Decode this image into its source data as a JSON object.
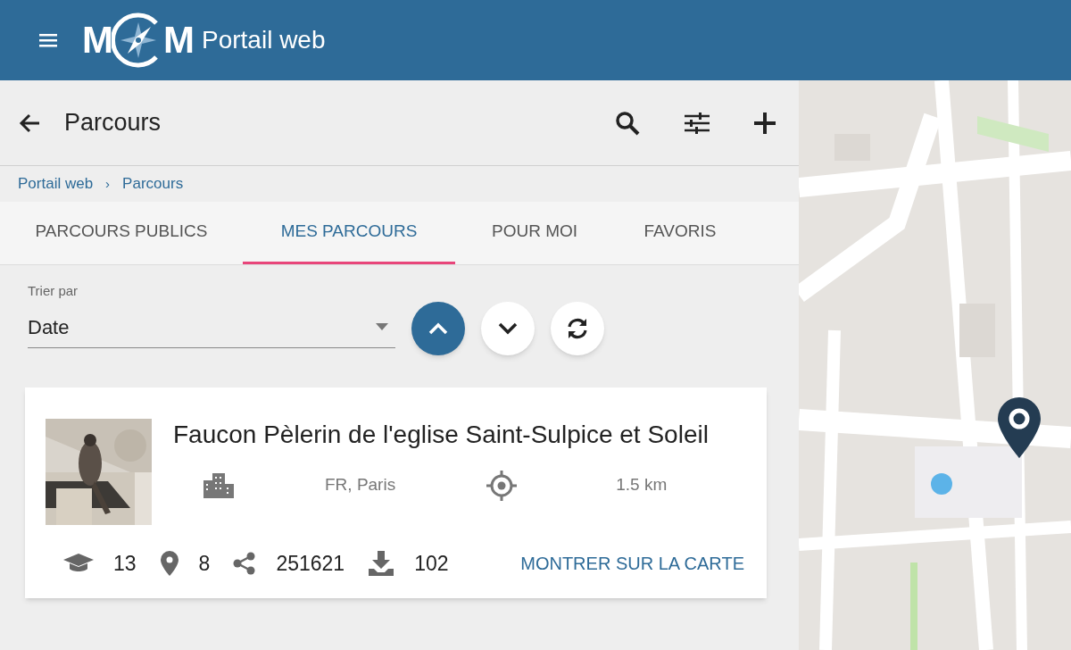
{
  "header": {
    "logo_letters": [
      "M",
      "M"
    ],
    "title": "Portail web"
  },
  "toolbar": {
    "title": "Parcours"
  },
  "breadcrumb": [
    "Portail web",
    "Parcours"
  ],
  "breadcrumb_separator": "›",
  "tabs": [
    {
      "label": "PARCOURS PUBLICS",
      "selected": false
    },
    {
      "label": "MES PARCOURS",
      "selected": true
    },
    {
      "label": "POUR MOI",
      "selected": false
    },
    {
      "label": "FAVORIS",
      "selected": false
    }
  ],
  "sort": {
    "label": "Trier par",
    "value": "Date",
    "buttons": [
      {
        "kind": "up",
        "selected": true
      },
      {
        "kind": "down",
        "selected": false
      },
      {
        "kind": "refresh",
        "selected": false
      }
    ]
  },
  "cards": [
    {
      "title": "Faucon Pèlerin de l'eglise Saint-Sulpice et Soleil",
      "place": "FR, Paris",
      "distance": "1.5 km",
      "stats": [
        {
          "kind": "cap",
          "value": "13"
        },
        {
          "kind": "pin",
          "value": "8"
        },
        {
          "kind": "share",
          "value": "251621"
        },
        {
          "kind": "download",
          "value": "102"
        }
      ],
      "action": "MONTRER SUR LA CARTE"
    }
  ],
  "map": {
    "kind": "picture"
  }
}
